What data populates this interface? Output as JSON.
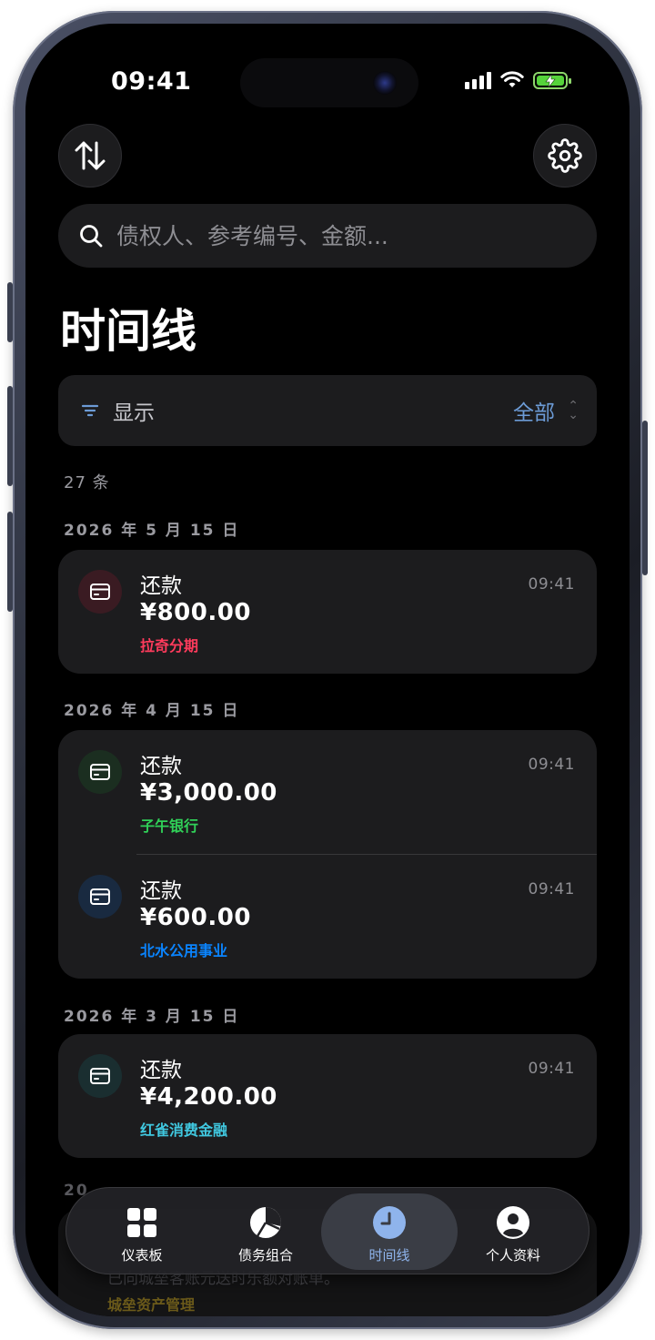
{
  "status": {
    "time": "09:41"
  },
  "search": {
    "placeholder": "债权人、参考编号、金额..."
  },
  "page_title": "时间线",
  "filter": {
    "label": "显示",
    "value": "全部"
  },
  "count": "27 条",
  "groups": [
    {
      "date": "2026 年 5 月 15 日",
      "entries": [
        {
          "type": "还款",
          "amount": "¥800.00",
          "creditor": "拉奇分期",
          "time": "09:41",
          "color": "#ff3b5c",
          "icon_bg": "#3a1b22"
        }
      ]
    },
    {
      "date": "2026 年 4 月 15 日",
      "entries": [
        {
          "type": "还款",
          "amount": "¥3,000.00",
          "creditor": "子午银行",
          "time": "09:41",
          "color": "#30d158",
          "icon_bg": "#1b2e20"
        },
        {
          "type": "还款",
          "amount": "¥600.00",
          "creditor": "北水公用事业",
          "time": "09:41",
          "color": "#0a84ff",
          "icon_bg": "#192a40"
        }
      ]
    },
    {
      "date": "2026 年 3 月 15 日",
      "entries": [
        {
          "type": "还款",
          "amount": "¥4,200.00",
          "creditor": "红雀消费金融",
          "time": "09:41",
          "color": "#40c8e0",
          "icon_bg": "#1a2e30"
        }
      ]
    }
  ],
  "peek": {
    "date": "20",
    "text": "已向城垒客账元送时乐额对账单。",
    "creditor": "城垒资产管理"
  },
  "tabs": [
    {
      "label": "仪表板",
      "icon": "grid-icon"
    },
    {
      "label": "债务组合",
      "icon": "pie-chart-icon"
    },
    {
      "label": "时间线",
      "icon": "clock-icon",
      "active": true
    },
    {
      "label": "个人资料",
      "icon": "person-icon"
    }
  ]
}
